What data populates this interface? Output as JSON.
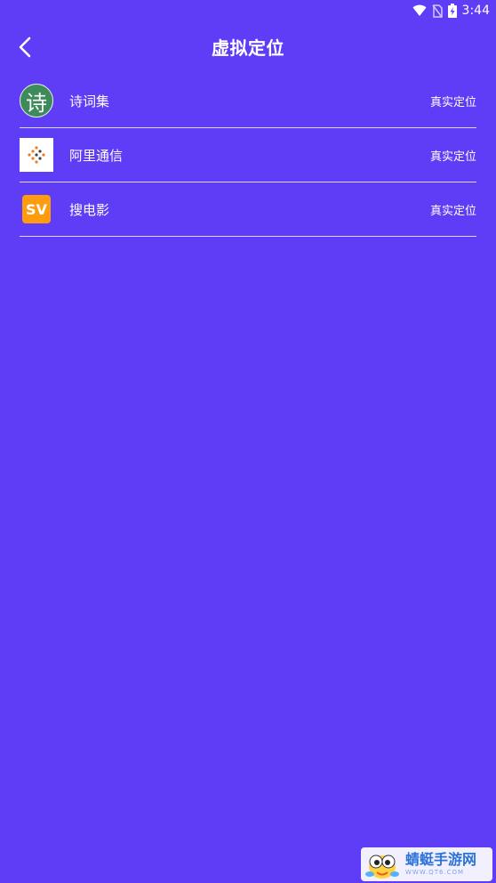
{
  "status_bar": {
    "time": "3:44",
    "icons": [
      "wifi-icon",
      "no-sim-icon",
      "battery-charging-icon"
    ]
  },
  "header": {
    "title": "虚拟定位",
    "back_icon": "chevron-left-icon"
  },
  "apps": [
    {
      "name": "诗词集",
      "status": "真实定位",
      "icon": "poem-app-icon",
      "icon_glyph": "诗"
    },
    {
      "name": "阿里通信",
      "status": "真实定位",
      "icon": "ali-telecom-app-icon"
    },
    {
      "name": "搜电影",
      "status": "真实定位",
      "icon": "sv-movie-app-icon",
      "icon_glyph": "SV"
    }
  ],
  "watermark": {
    "title": "蜻蜓手游网",
    "subtitle": "WWW.QT6.COM"
  },
  "colors": {
    "background": "#5f3cf6",
    "divider": "#d9d6ff",
    "sv_icon": "#ff9b0e",
    "poem_icon": "#3d8a5a"
  }
}
